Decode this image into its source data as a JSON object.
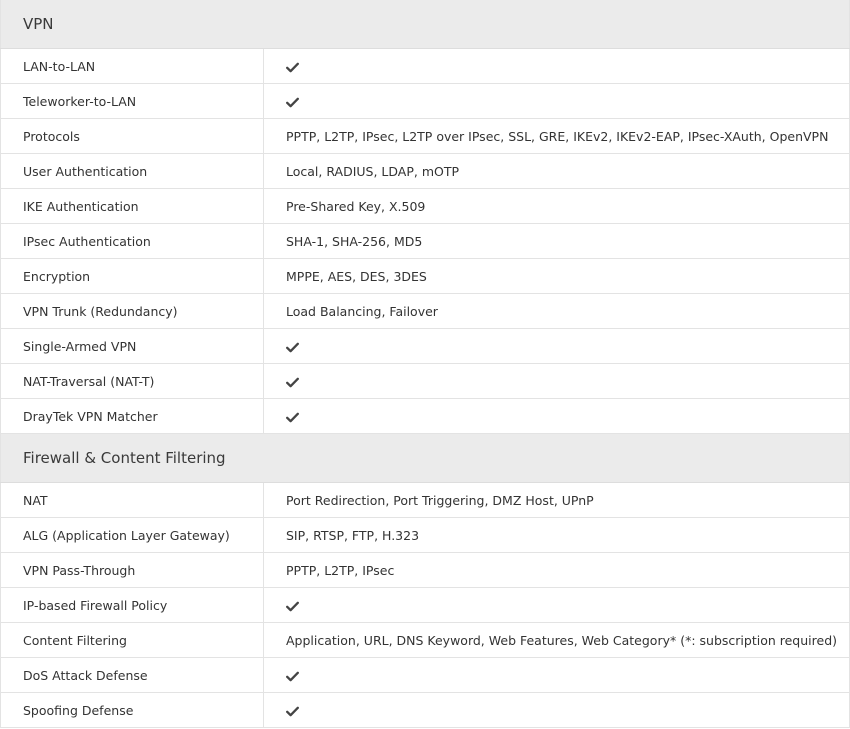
{
  "sections": [
    {
      "title": "VPN",
      "rows": [
        {
          "label": "LAN-to-LAN",
          "value": "",
          "check": true
        },
        {
          "label": "Teleworker-to-LAN",
          "value": "",
          "check": true
        },
        {
          "label": "Protocols",
          "value": "PPTP, L2TP, IPsec, L2TP over IPsec, SSL, GRE, IKEv2, IKEv2-EAP, IPsec-XAuth, OpenVPN",
          "check": false
        },
        {
          "label": "User Authentication",
          "value": "Local, RADIUS, LDAP, mOTP",
          "check": false
        },
        {
          "label": "IKE Authentication",
          "value": "Pre-Shared Key, X.509",
          "check": false
        },
        {
          "label": "IPsec Authentication",
          "value": "SHA-1, SHA-256, MD5",
          "check": false
        },
        {
          "label": "Encryption",
          "value": "MPPE, AES, DES, 3DES",
          "check": false
        },
        {
          "label": "VPN Trunk (Redundancy)",
          "value": "Load Balancing, Failover",
          "check": false
        },
        {
          "label": "Single-Armed VPN",
          "value": "",
          "check": true
        },
        {
          "label": "NAT-Traversal (NAT-T)",
          "value": "",
          "check": true
        },
        {
          "label": "DrayTek VPN Matcher",
          "value": "",
          "check": true
        }
      ]
    },
    {
      "title": "Firewall & Content Filtering",
      "rows": [
        {
          "label": "NAT",
          "value": "Port Redirection, Port Triggering, DMZ Host, UPnP",
          "check": false
        },
        {
          "label": "ALG (Application Layer Gateway)",
          "value": "SIP, RTSP, FTP, H.323",
          "check": false
        },
        {
          "label": "VPN Pass-Through",
          "value": "PPTP, L2TP, IPsec",
          "check": false
        },
        {
          "label": "IP-based Firewall Policy",
          "value": "",
          "check": true
        },
        {
          "label": "Content Filtering",
          "value": "Application, URL, DNS Keyword, Web Features, Web Category* (*: subscription required)",
          "check": false
        },
        {
          "label": "DoS Attack Defense",
          "value": "",
          "check": true
        },
        {
          "label": "Spoofing Defense",
          "value": "",
          "check": true
        }
      ]
    }
  ],
  "icons": {
    "check": "check-icon"
  },
  "colors": {
    "section_bg": "#ebebeb",
    "border": "#e3e3e3",
    "text": "#333333"
  }
}
